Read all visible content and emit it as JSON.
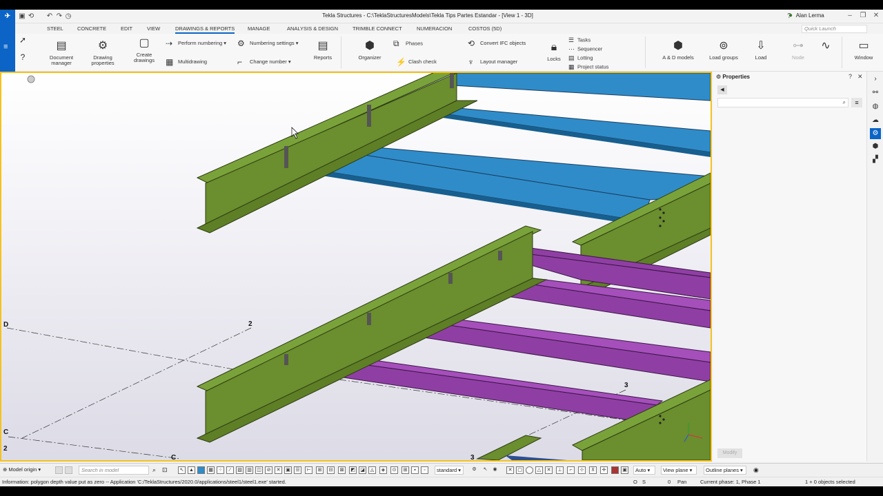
{
  "window": {
    "title": "Tekla Structures - C:\\TeklaStructuresModels\\Tekla Tips Partes Estandar  - [View 1 - 3D]",
    "user": "Alan Lerma",
    "quick_launch_placeholder": "Quick Launch"
  },
  "menu_tabs": [
    "STEEL",
    "CONCRETE",
    "EDIT",
    "VIEW",
    "DRAWINGS & REPORTS",
    "MANAGE",
    "ANALYSIS & DESIGN",
    "TRIMBLE CONNECT",
    "NUMERACION",
    "COSTOS (5D)"
  ],
  "active_tab": "DRAWINGS & REPORTS",
  "ribbon": {
    "document_manager": "Document manager",
    "drawing_properties": "Drawing properties",
    "create_drawings": "Create drawings",
    "perform_numbering": "Perform numbering",
    "numbering_settings": "Numbering settings",
    "multidrawing": "Multidrawing",
    "change_number": "Change number",
    "reports": "Reports",
    "organizer": "Organizer",
    "phases": "Phases",
    "clash_check": "Clash check",
    "convert_ifc": "Convert IFC objects",
    "layout_manager": "Layout manager",
    "locks": "Locks",
    "tasks": "Tasks",
    "sequencer": "Sequencer",
    "lotting": "Lotting",
    "project_status": "Project status",
    "ad_models": "A & D models",
    "load_groups": "Load groups",
    "load": "Load",
    "node": "Node",
    "window": "Window"
  },
  "viewport": {
    "grid_labels": [
      "D",
      "2",
      "C",
      "2",
      "C",
      "3",
      "3"
    ]
  },
  "properties": {
    "title": "Properties",
    "modify_label": "Modify"
  },
  "statusbar": {
    "model_origin": "Model origin",
    "search_placeholder": "Search in model",
    "standard": "standard",
    "auto": "Auto",
    "view_plane": "View plane",
    "outline_planes": "Outline planes"
  },
  "infobar": {
    "message": "Information: polygon depth value put as zero -- Application 'C:/TeklaStructures/2020.0/applications/steel1/steel1.exe' started.",
    "o_label": "O",
    "s_label": "S",
    "zero": "0",
    "pan": "Pan",
    "phase": "Current phase: 1, Phase 1",
    "selected": "1 + 0 objects selected"
  },
  "colors": {
    "accent": "#0b64c6",
    "column_green": "#6b8e2e",
    "beam_blue": "#2f8cc9",
    "beam_purple": "#8f3fa3",
    "viewport_border": "#f5c21b"
  }
}
